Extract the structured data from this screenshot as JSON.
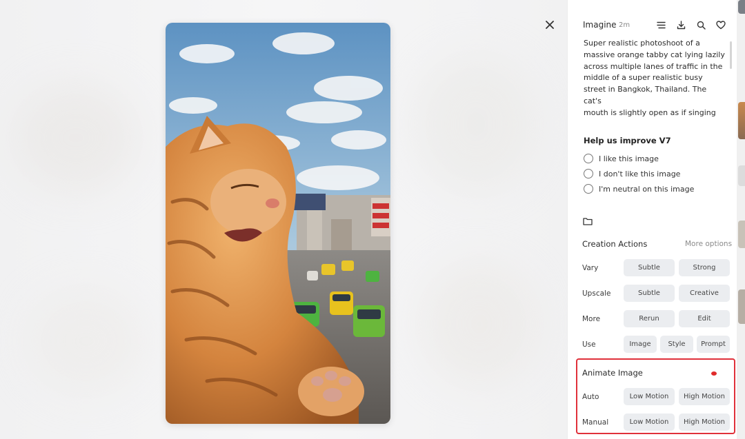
{
  "header": {
    "app_name": "Imagine",
    "time_ago": "2m"
  },
  "prompt": {
    "text": "Super realistic photoshoot of a\nmassive orange tabby cat lying lazily\nacross multiple lanes of traffic in the\nmiddle of a super realistic busy\nstreet in Bangkok, Thailand. The cat's\nmouth is slightly open as if singing"
  },
  "feedback": {
    "title": "Help us improve V7",
    "options": [
      "I like this image",
      "I don't like this image",
      "I'm neutral on this image"
    ]
  },
  "creation_actions": {
    "title": "Creation Actions",
    "more_options": "More options",
    "rows": [
      {
        "label": "Vary",
        "buttons": [
          "Subtle",
          "Strong"
        ]
      },
      {
        "label": "Upscale",
        "buttons": [
          "Subtle",
          "Creative"
        ]
      },
      {
        "label": "More",
        "buttons": [
          "Rerun",
          "Edit"
        ]
      },
      {
        "label": "Use",
        "buttons": [
          "Image",
          "Style",
          "Prompt"
        ]
      }
    ]
  },
  "animate": {
    "title": "Animate Image",
    "rows": [
      {
        "label": "Auto",
        "buttons": [
          "Low Motion",
          "High Motion"
        ]
      },
      {
        "label": "Manual",
        "buttons": [
          "Low Motion",
          "High Motion"
        ]
      }
    ],
    "highlight_color": "#e0303a"
  },
  "icons": [
    "close-icon",
    "list-icon",
    "download-icon",
    "search-icon",
    "heart-icon",
    "folder-icon"
  ],
  "colors": {
    "panel_bg": "#ffffff",
    "chip_bg": "#ebedf0",
    "highlight": "#e0303a"
  }
}
